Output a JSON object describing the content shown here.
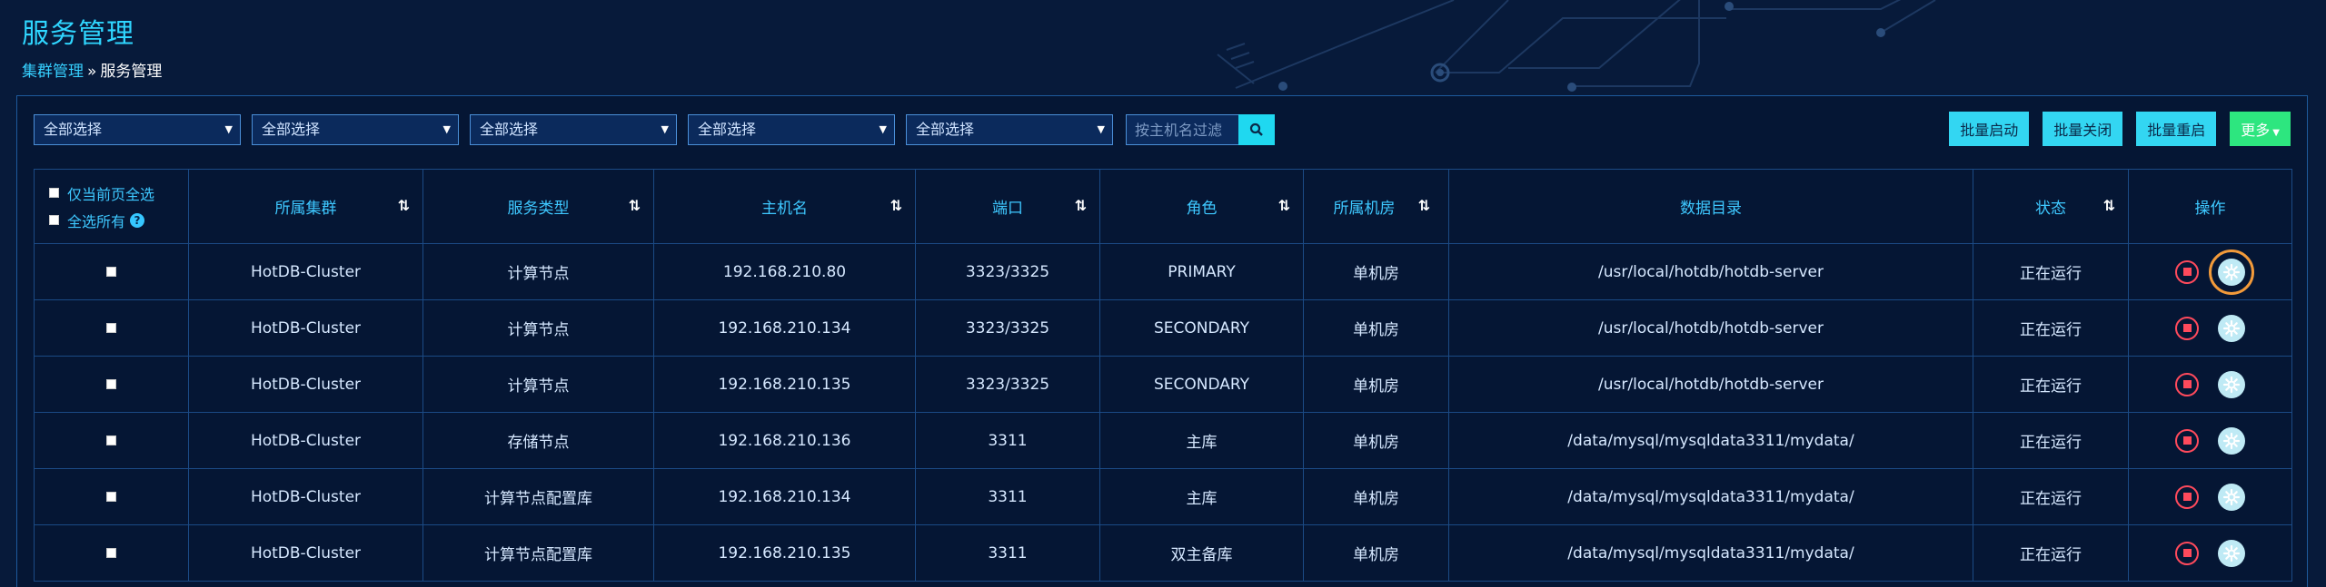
{
  "page": {
    "title": "服务管理",
    "breadcrumb": {
      "parent": "集群管理",
      "separator": "»",
      "current": "服务管理"
    }
  },
  "filters": {
    "selects": [
      "全部选择",
      "全部选择",
      "全部选择",
      "全部选择",
      "全部选择"
    ],
    "search_placeholder": "按主机名过滤"
  },
  "actions": {
    "batch_start": "批量启动",
    "batch_stop": "批量关闭",
    "batch_restart": "批量重启",
    "more": "更多"
  },
  "table": {
    "select_page": "仅当前页全选",
    "select_all": "全选所有",
    "help": "?",
    "columns": [
      "所属集群",
      "服务类型",
      "主机名",
      "端口",
      "角色",
      "所属机房",
      "数据目录",
      "状态",
      "操作"
    ],
    "rows": [
      [
        "HotDB-Cluster",
        "计算节点",
        "192.168.210.80",
        "3323/3325",
        "PRIMARY",
        "单机房",
        "/usr/local/hotdb/hotdb-server",
        "正在运行"
      ],
      [
        "HotDB-Cluster",
        "计算节点",
        "192.168.210.134",
        "3323/3325",
        "SECONDARY",
        "单机房",
        "/usr/local/hotdb/hotdb-server",
        "正在运行"
      ],
      [
        "HotDB-Cluster",
        "计算节点",
        "192.168.210.135",
        "3323/3325",
        "SECONDARY",
        "单机房",
        "/usr/local/hotdb/hotdb-server",
        "正在运行"
      ],
      [
        "HotDB-Cluster",
        "存储节点",
        "192.168.210.136",
        "3311",
        "主库",
        "单机房",
        "/data/mysql/mysqldata3311/mydata/",
        "正在运行"
      ],
      [
        "HotDB-Cluster",
        "计算节点配置库",
        "192.168.210.134",
        "3311",
        "主库",
        "单机房",
        "/data/mysql/mysqldata3311/mydata/",
        "正在运行"
      ],
      [
        "HotDB-Cluster",
        "计算节点配置库",
        "192.168.210.135",
        "3311",
        "双主备库",
        "单机房",
        "/data/mysql/mysqldata3311/mydata/",
        "正在运行"
      ]
    ]
  },
  "colors": {
    "accent": "#2fd6ff",
    "running": "#2fe07a",
    "stop": "#ff4a5c",
    "more_button": "#2de67f",
    "focus_outline": "#f29a3a"
  },
  "icons": [
    "caret-down-icon",
    "search-icon",
    "sort-icon",
    "stop-icon",
    "gear-icon",
    "help-icon"
  ]
}
